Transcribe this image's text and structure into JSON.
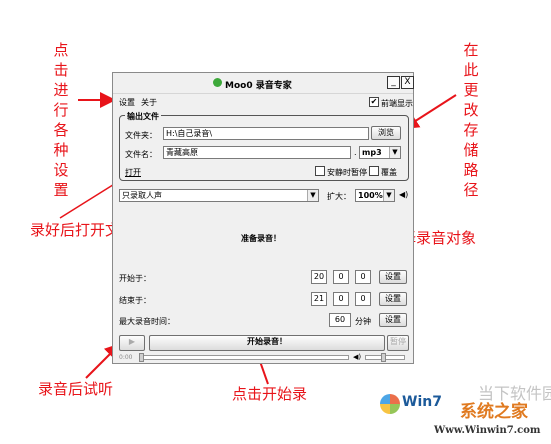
{
  "annotations": {
    "settings": "点击进行各种设置",
    "save_path": "在此更改存储路径",
    "open_folder": "录好后打开文件夹",
    "select_source": "选择录音对象",
    "listen": "录音后试听",
    "start": "点击开始录"
  },
  "window": {
    "title": "Moo0 录音专家",
    "minimize": "_",
    "close": "X",
    "menu": [
      "设置",
      "关于"
    ],
    "topmost_label": "前端显示",
    "topmost_checked": true
  },
  "output": {
    "legend": "输出文件",
    "folder_label": "文件夹：",
    "folder_value": "H:\\自己录音\\",
    "browse_button": "浏览",
    "filename_label": "文件名：",
    "filename_value": "青藏高原",
    "dot": ".",
    "format": "mp3",
    "open_link": "打开",
    "pause_on_silence": "安静时暂停",
    "overwrite": "覆盖"
  },
  "source": {
    "selected": "只录取人声",
    "zoom_label": "扩大：",
    "zoom_value": "100%"
  },
  "status": "准备录音！",
  "schedule": {
    "start_label": "开始于：",
    "start_values": [
      "20",
      "0",
      "0"
    ],
    "end_label": "结束于：",
    "end_values": [
      "21",
      "0",
      "0"
    ],
    "max_label": "最大录音时间：",
    "max_value": "60",
    "max_unit": "分钟",
    "set_button": "设置"
  },
  "playback": {
    "time": "0:00",
    "record_button": "开始录音！",
    "stop_button": "暂停"
  },
  "watermark": {
    "line1": "当下软件园",
    "brand_a": "Win7",
    "brand_b": "系统之家",
    "url": "Www.Winwin7.com"
  }
}
